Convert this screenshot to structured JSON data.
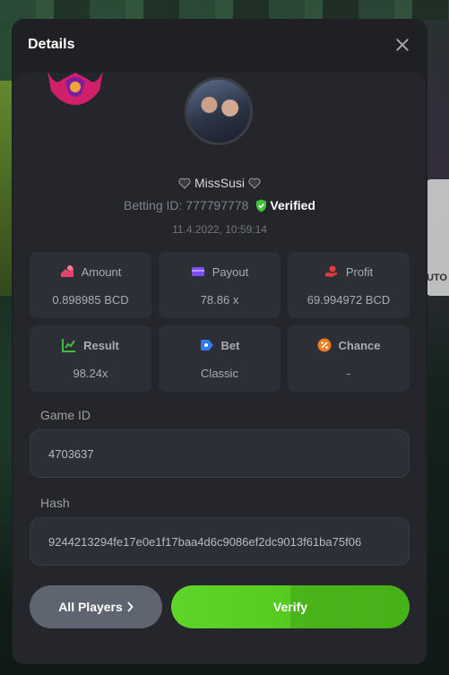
{
  "modal": {
    "title": "Details",
    "close_icon": "close-icon"
  },
  "player": {
    "username": "MissSusi",
    "betting_label": "Betting ID: 777797778",
    "verified_label": "Verified",
    "timestamp": "11.4.2022, 10:59:14"
  },
  "stats": [
    {
      "label": "Amount",
      "value": "0.898985 BCD",
      "icon": "amount-icon",
      "color": "#e8436a"
    },
    {
      "label": "Payout",
      "value": "78.86 x",
      "icon": "payout-icon",
      "color": "#7c4dff"
    },
    {
      "label": "Profit",
      "value": "69.994972 BCD",
      "icon": "profit-icon",
      "color": "#e23b3b"
    },
    {
      "label": "Result",
      "value": "98.24x",
      "icon": "result-icon",
      "color": "#3fbf3f"
    },
    {
      "label": "Bet",
      "value": "Classic",
      "icon": "bet-icon",
      "color": "#2f7cf6"
    },
    {
      "label": "Chance",
      "value": "-",
      "icon": "chance-icon",
      "color": "#f07c1e"
    }
  ],
  "game_id": {
    "label": "Game ID",
    "value": "4703637"
  },
  "hash": {
    "label": "Hash",
    "value": "9244213294fe17e0e1f17baa4d6c9086ef2dc9013f61ba75f06"
  },
  "buttons": {
    "all_players": "All Players",
    "verify": "Verify"
  },
  "background": {
    "side_text": "UTO"
  }
}
